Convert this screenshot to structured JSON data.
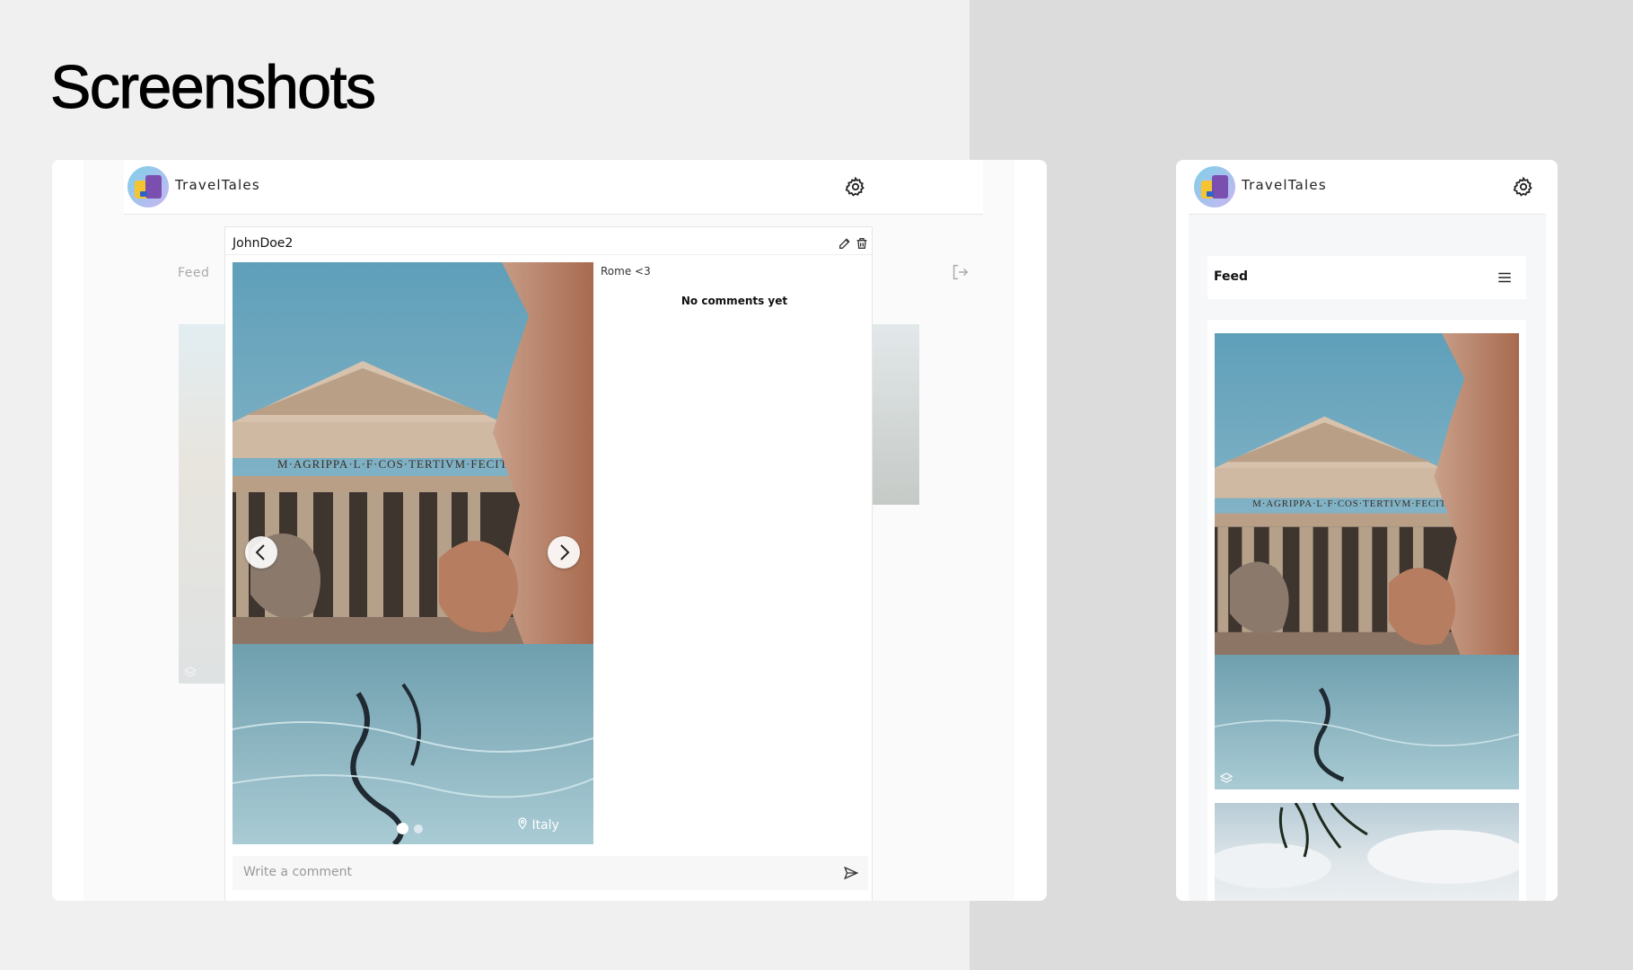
{
  "page": {
    "title": "Screenshots"
  },
  "desktop": {
    "brand": "TravelTales",
    "feed_label": "Feed",
    "post": {
      "username": "JohnDoe2",
      "caption": "Rome <3",
      "no_comments": "No comments yet",
      "location": "Italy",
      "inscription": "M·AGRIPPA·L·F·COS·TERTIVM·FECIT",
      "comment_placeholder": "Write a comment",
      "carousel": {
        "count": 2,
        "active": 1
      }
    }
  },
  "mobile": {
    "brand": "TravelTales",
    "feed_label": "Feed",
    "inscription": "M·AGRIPPA·L·F·COS·TERTIVM·FECIT"
  },
  "icons": [
    "gear-icon",
    "logout-icon",
    "edit-icon",
    "trash-icon",
    "chevron-left-icon",
    "chevron-right-icon",
    "location-pin-icon",
    "send-icon",
    "menu-icon",
    "layers-icon"
  ],
  "colors": {
    "page_bg": "#f0f0f0",
    "right_bg": "#dcdcdc",
    "surface": "#ffffff"
  }
}
